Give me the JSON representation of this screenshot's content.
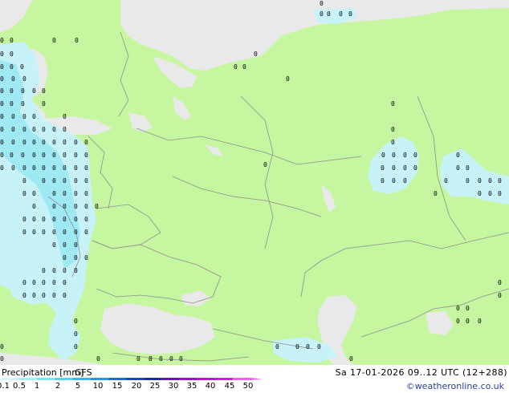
{
  "legend": {
    "title": "Precipitation [mm]",
    "model": "GFS",
    "scale_labels": [
      "0.1",
      "0.5",
      "1",
      "2",
      "5",
      "10",
      "15",
      "20",
      "25",
      "30",
      "35",
      "40",
      "45",
      "50"
    ],
    "scale_colors": [
      "#d3f6fb",
      "#a8eef8",
      "#7de5f5",
      "#52d6f0",
      "#35b8e6",
      "#2596dc",
      "#1b6fd0",
      "#1949b8",
      "#1d2aa0",
      "#6a12b8",
      "#9a0fc8",
      "#c40ed8",
      "#e010e0",
      "#f05ff0"
    ]
  },
  "run_info": "Sa 17-01-2026 09..12 UTC (12+288)",
  "credit": "©weatheronline.co.uk",
  "map": {
    "land_color": "#c6f7a0",
    "sea_color": "#e9e9e9",
    "precip_light_color": "#c7f3f8",
    "precip_medium_color": "#9fe9f5",
    "border_color": "#8e8e8e",
    "marker_glyph": "0"
  }
}
